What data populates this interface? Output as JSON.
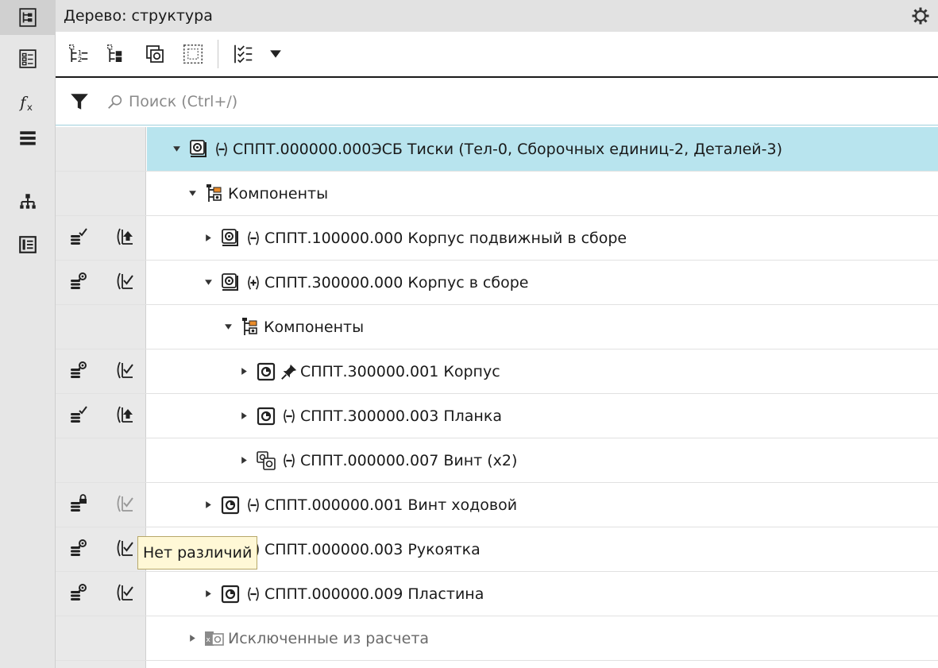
{
  "panel": {
    "title": "Дерево: структура",
    "search_placeholder": "Поиск (Ctrl+/)"
  },
  "side_strip": [
    "tree-structure-icon",
    "properties-icon",
    "variables-icon",
    "layers-icon",
    "hierarchy-icon",
    "document-icon"
  ],
  "toolbar": [
    "tree-flat-icon",
    "tree-structure-icon",
    "component-view-icon",
    "selection-frame-icon",
    "checklist-icon",
    "dropdown-arrow-icon"
  ],
  "tree": {
    "rows": [
      {
        "label": "СППТ.000000.000ЭСБ Тиски (Тел-0, Сборочных единиц-2, Деталей-3)",
        "state": "(−)",
        "icon": "assembly-icon",
        "expanded": true,
        "selected": true
      },
      {
        "label": "Компоненты",
        "icon": "components-folder-icon",
        "expanded": true
      },
      {
        "label": "СППТ.100000.000 Корпус подвижный в сборе",
        "state": "(−)",
        "icon": "assembly-icon",
        "expanded": false,
        "col1": "db-check-icon",
        "col2": "revision-up-icon"
      },
      {
        "label": "СППТ.300000.000 Корпус в сборе",
        "state": "(+)",
        "icon": "assembly-icon",
        "expanded": true,
        "col1": "db-view-icon",
        "col2": "revision-ok-icon"
      },
      {
        "label": "Компоненты",
        "icon": "components-folder-icon",
        "expanded": true
      },
      {
        "label": "СППТ.300000.001 Корпус",
        "state": "pin",
        "icon": "part-icon",
        "expanded": false,
        "col1": "db-view-icon",
        "col2": "revision-ok-icon"
      },
      {
        "label": "СППТ.300000.003 Планка",
        "state": "(−)",
        "icon": "part-icon",
        "expanded": false,
        "col1": "db-check-icon",
        "col2": "revision-up-icon"
      },
      {
        "label": "СППТ.000000.007 Винт (x2)",
        "state": "(−)",
        "icon": "multi-part-icon",
        "expanded": false
      },
      {
        "label": "СППТ.000000.001 Винт ходовой",
        "state": "(−)",
        "icon": "part-icon",
        "expanded": false,
        "col1": "db-lock-icon",
        "col2": "revision-ok-dim-icon"
      },
      {
        "label": "СППТ.000000.003 Рукоятка",
        "state": "(−)",
        "icon": "part-icon",
        "expanded": false,
        "col1": "db-view-icon",
        "col2": "revision-ok-icon"
      },
      {
        "label": "СППТ.000000.009 Пластина",
        "state": "(−)",
        "icon": "part-icon",
        "expanded": false,
        "col1": "db-view-icon",
        "col2": "revision-ok-icon"
      },
      {
        "label": "Исключенные из расчета",
        "icon": "excluded-folder-icon",
        "expanded": false,
        "dim": true
      }
    ]
  },
  "tooltip": {
    "text": "Нет различий"
  },
  "colors": {
    "selection": "#b8e4ee",
    "strip": "#e6e6e6",
    "header": "#e2e2e2",
    "tooltip_bg": "#fff8d6"
  }
}
